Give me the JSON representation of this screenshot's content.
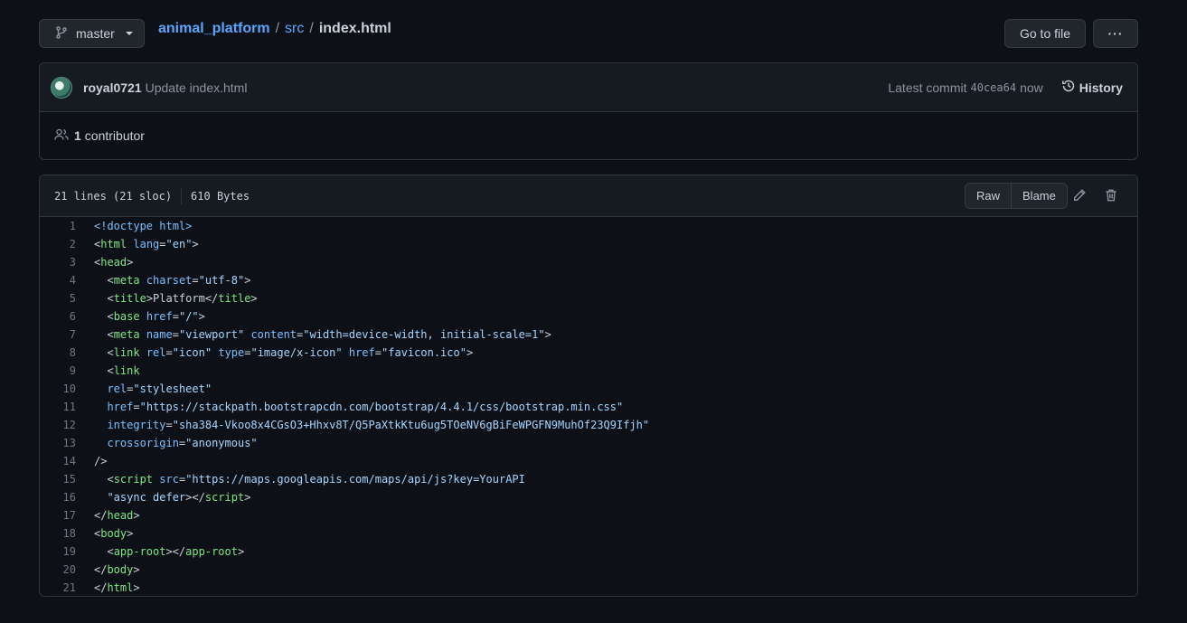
{
  "branch": {
    "label": "master"
  },
  "breadcrumb": {
    "repo": "animal_platform",
    "dir": "src",
    "sep": "/",
    "file": "index.html"
  },
  "actions": {
    "goto_label": "Go to file",
    "more_label": "···"
  },
  "commit": {
    "author": "royal0721",
    "message": "Update index.html",
    "latest_label": "Latest commit",
    "hash": "40cea64",
    "time": "now",
    "history_label": "History"
  },
  "contributors": {
    "count": "1",
    "label": "contributor"
  },
  "file": {
    "lines_info": "21 lines (21 sloc)",
    "size": "610 Bytes",
    "raw_label": "Raw",
    "blame_label": "Blame"
  },
  "icons": {
    "branch": "git-branch-icon",
    "history": "history-icon",
    "people": "people-icon",
    "edit": "pencil-icon",
    "delete": "trash-icon"
  },
  "colors": {
    "background": "#0d1117",
    "link": "#58a6ff",
    "tag": "#7ee787",
    "attr": "#79c0ff",
    "string": "#a5d6ff"
  },
  "code_lines": [
    [
      [
        "attr",
        "<!doctype html>"
      ]
    ],
    [
      [
        "p",
        "<"
      ],
      [
        "tag",
        "html"
      ],
      [
        "p",
        " "
      ],
      [
        "attr",
        "lang"
      ],
      [
        "p",
        "="
      ],
      [
        "str",
        "\"en\""
      ],
      [
        "p",
        ">"
      ]
    ],
    [
      [
        "p",
        "<"
      ],
      [
        "tag",
        "head"
      ],
      [
        "p",
        ">"
      ]
    ],
    [
      [
        "p",
        "  <"
      ],
      [
        "tag",
        "meta"
      ],
      [
        "p",
        " "
      ],
      [
        "attr",
        "charset"
      ],
      [
        "p",
        "="
      ],
      [
        "str",
        "\"utf-8\""
      ],
      [
        "p",
        ">"
      ]
    ],
    [
      [
        "p",
        "  <"
      ],
      [
        "tag",
        "title"
      ],
      [
        "p",
        ">Platform</"
      ],
      [
        "tag",
        "title"
      ],
      [
        "p",
        ">"
      ]
    ],
    [
      [
        "p",
        "  <"
      ],
      [
        "tag",
        "base"
      ],
      [
        "p",
        " "
      ],
      [
        "attr",
        "href"
      ],
      [
        "p",
        "="
      ],
      [
        "str",
        "\"/\""
      ],
      [
        "p",
        ">"
      ]
    ],
    [
      [
        "p",
        "  <"
      ],
      [
        "tag",
        "meta"
      ],
      [
        "p",
        " "
      ],
      [
        "attr",
        "name"
      ],
      [
        "p",
        "="
      ],
      [
        "str",
        "\"viewport\""
      ],
      [
        "p",
        " "
      ],
      [
        "attr",
        "content"
      ],
      [
        "p",
        "="
      ],
      [
        "str",
        "\"width=device-width, initial-scale=1\""
      ],
      [
        "p",
        ">"
      ]
    ],
    [
      [
        "p",
        "  <"
      ],
      [
        "tag",
        "link"
      ],
      [
        "p",
        " "
      ],
      [
        "attr",
        "rel"
      ],
      [
        "p",
        "="
      ],
      [
        "str",
        "\"icon\""
      ],
      [
        "p",
        " "
      ],
      [
        "attr",
        "type"
      ],
      [
        "p",
        "="
      ],
      [
        "str",
        "\"image/x-icon\""
      ],
      [
        "p",
        " "
      ],
      [
        "attr",
        "href"
      ],
      [
        "p",
        "="
      ],
      [
        "str",
        "\"favicon.ico\""
      ],
      [
        "p",
        ">"
      ]
    ],
    [
      [
        "p",
        "  <"
      ],
      [
        "tag",
        "link"
      ]
    ],
    [
      [
        "p",
        "  "
      ],
      [
        "attr",
        "rel"
      ],
      [
        "p",
        "="
      ],
      [
        "str",
        "\"stylesheet\""
      ]
    ],
    [
      [
        "p",
        "  "
      ],
      [
        "attr",
        "href"
      ],
      [
        "p",
        "="
      ],
      [
        "str",
        "\"https://stackpath.bootstrapcdn.com/bootstrap/4.4.1/css/bootstrap.min.css\""
      ]
    ],
    [
      [
        "p",
        "  "
      ],
      [
        "attr",
        "integrity"
      ],
      [
        "p",
        "="
      ],
      [
        "str",
        "\"sha384-Vkoo8x4CGsO3+Hhxv8T/Q5PaXtkKtu6ug5TOeNV6gBiFeWPGFN9MuhOf23Q9Ifjh\""
      ]
    ],
    [
      [
        "p",
        "  "
      ],
      [
        "attr",
        "crossorigin"
      ],
      [
        "p",
        "="
      ],
      [
        "str",
        "\"anonymous\""
      ]
    ],
    [
      [
        "p",
        "/>"
      ]
    ],
    [
      [
        "p",
        "  <"
      ],
      [
        "tag",
        "script"
      ],
      [
        "p",
        " "
      ],
      [
        "attr",
        "src"
      ],
      [
        "p",
        "="
      ],
      [
        "str",
        "\"https://maps.googleapis.com/maps/api/js?key=YourAPI"
      ]
    ],
    [
      [
        "p",
        "  "
      ],
      [
        "str",
        "\"async defer"
      ],
      [
        "p",
        "></"
      ],
      [
        "tag",
        "script"
      ],
      [
        "p",
        ">"
      ]
    ],
    [
      [
        "p",
        "</"
      ],
      [
        "tag",
        "head"
      ],
      [
        "p",
        ">"
      ]
    ],
    [
      [
        "p",
        "<"
      ],
      [
        "tag",
        "body"
      ],
      [
        "p",
        ">"
      ]
    ],
    [
      [
        "p",
        "  <"
      ],
      [
        "tag",
        "app-root"
      ],
      [
        "p",
        "></"
      ],
      [
        "tag",
        "app-root"
      ],
      [
        "p",
        ">"
      ]
    ],
    [
      [
        "p",
        "</"
      ],
      [
        "tag",
        "body"
      ],
      [
        "p",
        ">"
      ]
    ],
    [
      [
        "p",
        "</"
      ],
      [
        "tag",
        "html"
      ],
      [
        "p",
        ">"
      ]
    ]
  ]
}
